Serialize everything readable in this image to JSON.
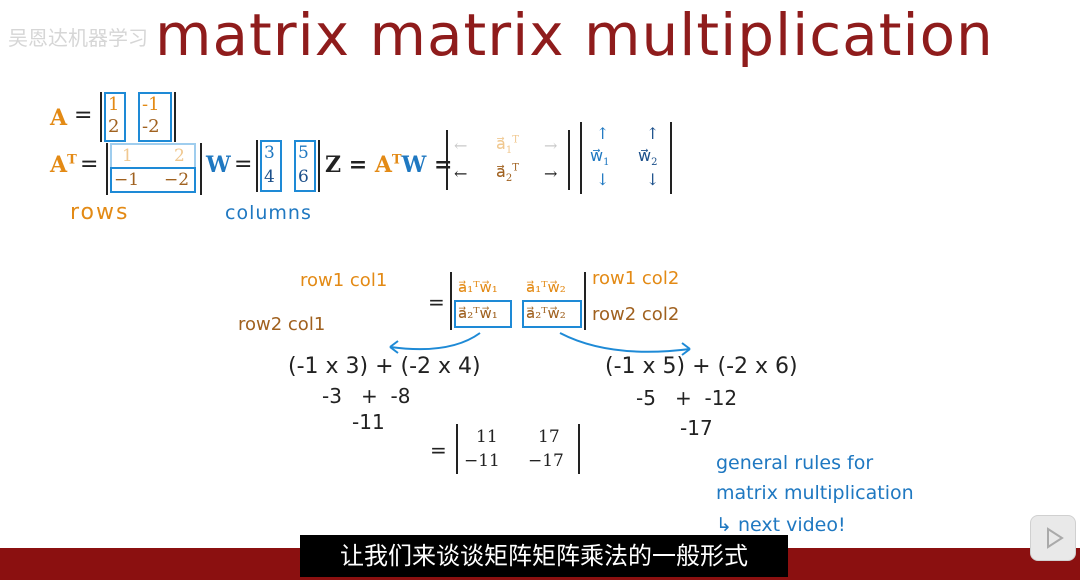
{
  "watermark": "吴恩达机器学习",
  "title": "matrix matrix multiplication",
  "defs": {
    "A_label": "A",
    "A_eq": "=",
    "A_vals": [
      "1",
      "2",
      "-1",
      "-2"
    ],
    "AT_label": "A",
    "AT_sup": "T",
    "AT_eq": "=",
    "AT_row1": [
      "1",
      "2"
    ],
    "AT_row2": [
      "−1",
      "−2"
    ],
    "W_label": "W",
    "W_eq": "=",
    "W_vals": [
      "3",
      "4",
      "5",
      "6"
    ],
    "Z_expr_Z": "Z =",
    "Z_expr_A": "A",
    "Z_expr_T": "T",
    "Z_expr_W": "W",
    "Z_eq": "=",
    "Z_row1": [
      "←",
      "a⃗",
      "1",
      "T",
      "→"
    ],
    "Z_row2": [
      "←",
      "a⃗",
      "2",
      "T",
      "→"
    ],
    "W_cols": [
      "↑",
      "w⃗",
      "1",
      "↓",
      "↑",
      "w⃗",
      "2",
      "↓"
    ],
    "rows_note": "rows",
    "columns_note": "columns"
  },
  "product": {
    "labels": {
      "r1c1": "row1 col1",
      "r1c2": "row1 col2",
      "r2c1": "row2 col1",
      "r2c2": "row2 col2"
    },
    "eq": "=",
    "entries": [
      "a⃗₁ᵀw⃗₁",
      "a⃗₁ᵀw⃗₂",
      "a⃗₂ᵀw⃗₁",
      "a⃗₂ᵀw⃗₂"
    ],
    "calc_left_line1": "(-1 x 3) + (-2 x 4)",
    "calc_left_line2": "-3   +  -8",
    "calc_left_line3": "-11",
    "calc_right_line1": "(-1 x 5) + (-2 x 6)",
    "calc_right_line2": "-5   +  -12",
    "calc_right_line3": "-17",
    "result_eq": "=",
    "result": [
      "11",
      "17",
      "−11",
      "−17"
    ]
  },
  "notes": {
    "line1": "general rules for",
    "line2": "matrix multiplication",
    "line3": "↳ next video!"
  },
  "subtitle": "让我们来谈谈矩阵矩阵乘法的一般形式"
}
